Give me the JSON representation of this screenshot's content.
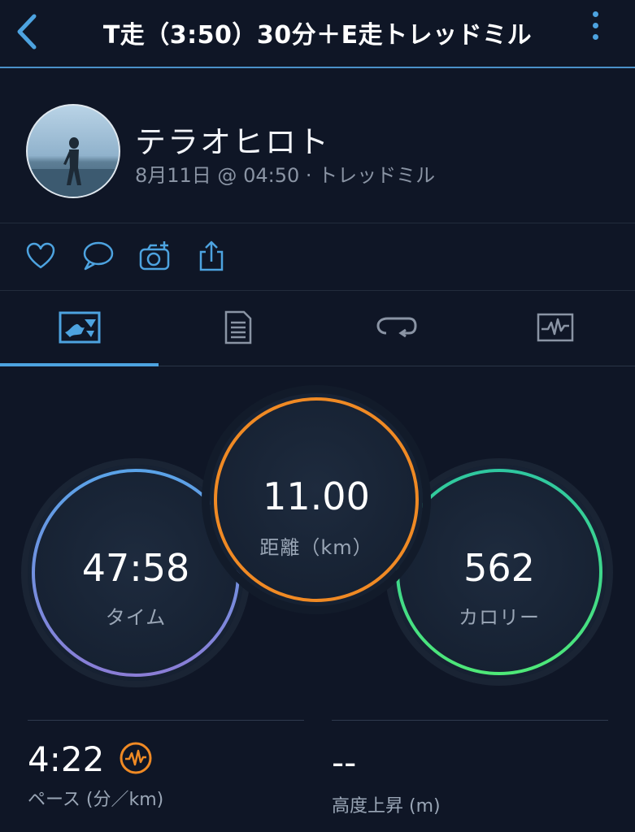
{
  "header": {
    "title": "T走（3:50）30分＋E走トレッドミル",
    "back_icon": "chevron-left-icon",
    "menu_icon": "more-vertical-icon",
    "accent": "#4da3e0"
  },
  "profile": {
    "name": "テラオヒロト",
    "meta": "8月11日 @ 04:50 · トレッドミル"
  },
  "actions": [
    "heart-icon",
    "comment-icon",
    "add-photo-icon",
    "share-icon"
  ],
  "tabs": [
    {
      "icon": "map-icon",
      "selected": true
    },
    {
      "icon": "details-icon",
      "selected": false
    },
    {
      "icon": "laps-icon",
      "selected": false
    },
    {
      "icon": "stats-chart-icon",
      "selected": false
    }
  ],
  "summary": {
    "time": {
      "value": "47:58",
      "label": "タイム",
      "color": "#5aa3e8"
    },
    "distance": {
      "value": "11.00",
      "label": "距離（km）",
      "color": "#f08a24"
    },
    "calories": {
      "value": "562",
      "label": "カロリー",
      "color": "#3ee08a"
    }
  },
  "stats": {
    "pace": {
      "value": "4:22",
      "label": "ペース (分／km)",
      "icon": "pace-wave-icon",
      "icon_color": "#f08a24"
    },
    "elevation": {
      "value": "--",
      "label": "高度上昇 (m)"
    }
  }
}
